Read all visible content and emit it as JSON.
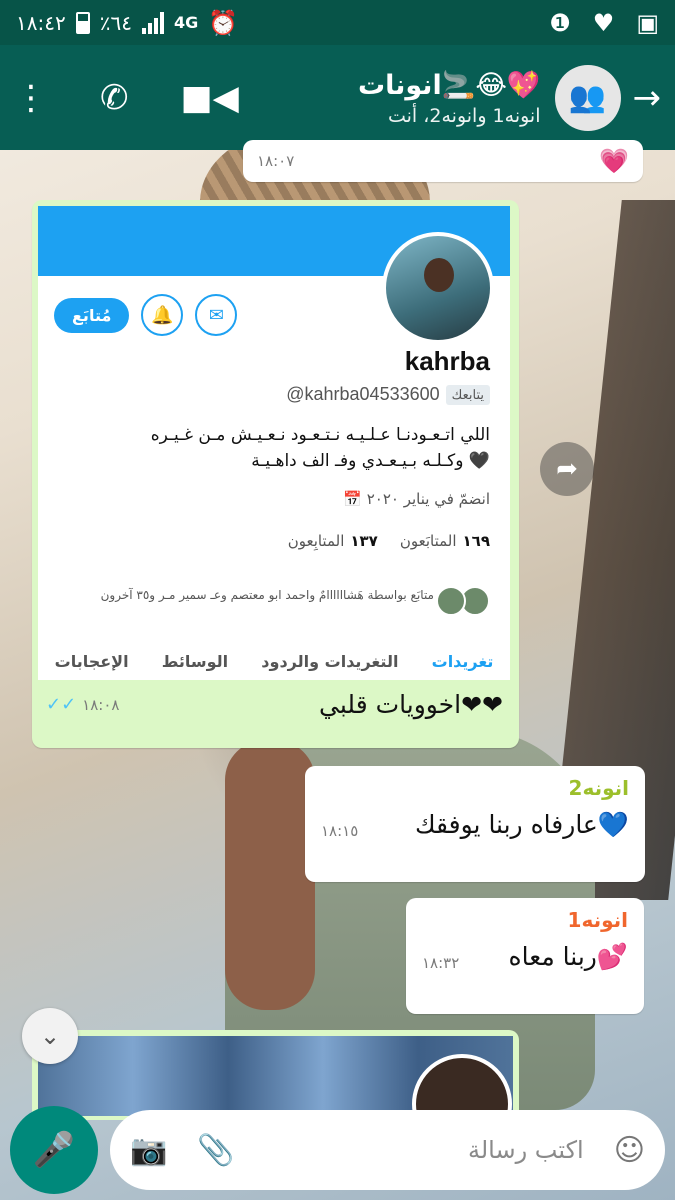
{
  "status_bar": {
    "time": "١٨:٤٢",
    "battery": "٪٦٤",
    "network": "4G"
  },
  "header": {
    "group_name": "انونات🚬😂💖",
    "members": "انونه1 وانونه2، أنت",
    "icons": [
      "more-vert-icon",
      "phone-icon",
      "video-call-icon",
      "group-avatar-icon",
      "back-arrow-icon"
    ]
  },
  "messages": {
    "partial_top": {
      "time": "١٨:٠٧"
    },
    "shared_profile": {
      "name": "kahrba",
      "handle": "@kahrba04533600",
      "follows_you": "يتابعك",
      "follow_button": "مُتابَع",
      "bio_line1": "اللي اتـعـودنـا عـلـيـه نـتـعـود نـعـيـش مـن غـيـره",
      "bio_line2": "وكـلـه بـيـعـدي وفـ الف داهـيـة 🖤",
      "joined": "انضمّ في يناير ٢٠٢٠",
      "following_count": "١٦٩",
      "following_label": "المتابَعون",
      "followers_count": "١٣٧",
      "followers_label": "المتابِعون",
      "mutual": "متابَع بواسطة هَشاااااامٌ واحمد ابو معتصم وعـ سمير مـر و٣٥ آخرون",
      "tabs": [
        "تغريدات",
        "التغريدات والردود",
        "الوسائط",
        "الإعجابات"
      ],
      "caption": "اخوويات قلبي❤❤",
      "time": "١٨:٠٨"
    },
    "msg2": {
      "sender": "انونه2",
      "text": "عارفاه ربنا يوفقك💙",
      "time": "١٨:١٥"
    },
    "msg3": {
      "sender": "انونه1",
      "text": "ربنا معاه💕",
      "time": "١٨:٣٢"
    }
  },
  "composer": {
    "placeholder": "اكتب رسالة"
  },
  "colors": {
    "header": "#075e54",
    "status": "#075448",
    "outgoing": "#dcf8c6",
    "accent": "#00897b"
  }
}
